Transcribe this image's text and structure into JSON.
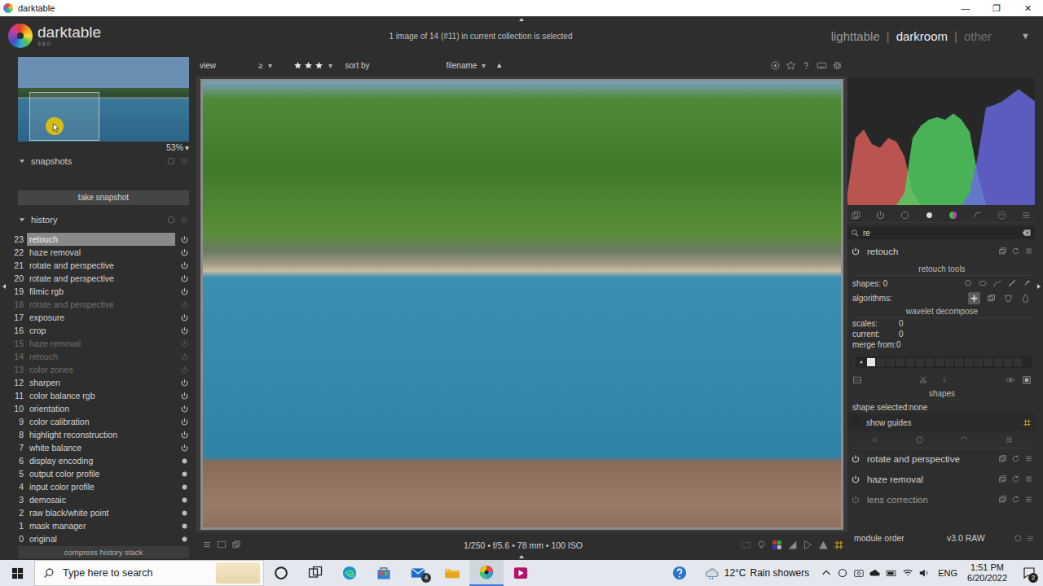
{
  "window": {
    "title": "darktable",
    "controls": [
      "—",
      "❐",
      "✕"
    ]
  },
  "header": {
    "logo": "darktable",
    "version": "3.8.0",
    "status": "1 image of 14 (#11) in current collection is selected",
    "views": [
      {
        "label": "lighttable",
        "selected": false
      },
      {
        "label": "darkroom",
        "selected": true
      },
      {
        "label": "other",
        "selected": false
      }
    ],
    "separator": "|",
    "menu": "▼"
  },
  "navigation": {
    "zoom": "53%",
    "zoom_menu": "▾"
  },
  "snapshots": {
    "title": "snapshots",
    "expanded": true,
    "button": "take snapshot"
  },
  "history": {
    "title": "history",
    "expanded": true,
    "items": [
      {
        "num": "23",
        "label": "retouch",
        "selected": true,
        "enabled": true,
        "kind": "toggle"
      },
      {
        "num": "22",
        "label": "haze removal",
        "selected": false,
        "enabled": true,
        "kind": "toggle"
      },
      {
        "num": "21",
        "label": "rotate and perspective",
        "selected": false,
        "enabled": true,
        "kind": "toggle"
      },
      {
        "num": "20",
        "label": "rotate and perspective",
        "selected": false,
        "enabled": true,
        "kind": "toggle"
      },
      {
        "num": "19",
        "label": "filmic rgb",
        "selected": false,
        "enabled": true,
        "kind": "toggle"
      },
      {
        "num": "18",
        "label": "rotate and perspective",
        "selected": false,
        "enabled": false,
        "kind": "toggle"
      },
      {
        "num": "17",
        "label": "exposure",
        "selected": false,
        "enabled": true,
        "kind": "toggle"
      },
      {
        "num": "16",
        "label": "crop",
        "selected": false,
        "enabled": true,
        "kind": "toggle"
      },
      {
        "num": "15",
        "label": "haze removal",
        "selected": false,
        "enabled": false,
        "kind": "toggle"
      },
      {
        "num": "14",
        "label": "retouch",
        "selected": false,
        "enabled": false,
        "kind": "toggle"
      },
      {
        "num": "13",
        "label": "color zones",
        "selected": false,
        "enabled": false,
        "kind": "toggle"
      },
      {
        "num": "12",
        "label": "sharpen",
        "selected": false,
        "enabled": true,
        "kind": "toggle"
      },
      {
        "num": "11",
        "label": "color balance rgb",
        "selected": false,
        "enabled": true,
        "kind": "toggle"
      },
      {
        "num": "10",
        "label": "orientation",
        "selected": false,
        "enabled": true,
        "kind": "toggle"
      },
      {
        "num": "9",
        "label": "color calibration",
        "selected": false,
        "enabled": true,
        "kind": "toggle"
      },
      {
        "num": "8",
        "label": "highlight reconstruction",
        "selected": false,
        "enabled": true,
        "kind": "toggle"
      },
      {
        "num": "7",
        "label": "white balance",
        "selected": false,
        "enabled": true,
        "kind": "toggle"
      },
      {
        "num": "6",
        "label": "display encoding",
        "selected": false,
        "enabled": true,
        "kind": "fixed"
      },
      {
        "num": "5",
        "label": "output color profile",
        "selected": false,
        "enabled": true,
        "kind": "fixed"
      },
      {
        "num": "4",
        "label": "input color profile",
        "selected": false,
        "enabled": true,
        "kind": "fixed"
      },
      {
        "num": "3",
        "label": "demosaic",
        "selected": false,
        "enabled": true,
        "kind": "fixed"
      },
      {
        "num": "2",
        "label": "raw black/white point",
        "selected": false,
        "enabled": true,
        "kind": "fixed"
      },
      {
        "num": "1",
        "label": "mask manager",
        "selected": false,
        "enabled": true,
        "kind": "fixed"
      },
      {
        "num": "0",
        "label": "original",
        "selected": false,
        "enabled": true,
        "kind": "fixed"
      }
    ],
    "footer": "compress history stack"
  },
  "toolbar": {
    "view": "view",
    "comparator": "≥",
    "comparator_menu": "▾",
    "stars": 3,
    "rating_menu": "▾",
    "sort_label": "sort by",
    "sort_field": "filename",
    "sort_menu": "▾",
    "sort_order": "▲"
  },
  "image_info": "1/250 • f/5.6 • 78 mm • 100 ISO",
  "histogram": {
    "series": [
      {
        "color": "#e0605c",
        "values": [
          0.1,
          0.55,
          0.62,
          0.5,
          0.47,
          0.55,
          0.52,
          0.4,
          0.1,
          0,
          0,
          0,
          0,
          0,
          0,
          0,
          0,
          0,
          0,
          0,
          0,
          0,
          0,
          0
        ]
      },
      {
        "color": "#52d463",
        "values": [
          0,
          0,
          0,
          0,
          0,
          0,
          0,
          0.1,
          0.55,
          0.65,
          0.7,
          0.72,
          0.7,
          0.75,
          0.7,
          0.6,
          0.25,
          0,
          0,
          0,
          0,
          0,
          0,
          0
        ]
      },
      {
        "color": "#6a6ae6",
        "values": [
          0,
          0,
          0,
          0,
          0,
          0,
          0,
          0,
          0,
          0,
          0,
          0,
          0,
          0,
          0,
          0.1,
          0.4,
          0.8,
          0.82,
          0.85,
          0.9,
          0.95,
          0.9,
          0.85
        ]
      }
    ]
  },
  "module_search": {
    "value": "re"
  },
  "retouch": {
    "name": "retouch",
    "enabled": true,
    "expanded": true,
    "tools_title": "retouch tools",
    "shapes_label": "shapes: 0",
    "algorithms_label": "algorithms:",
    "algorithms": [
      {
        "selected": true
      },
      {
        "selected": false
      },
      {
        "selected": false
      },
      {
        "selected": false
      }
    ],
    "wavelet_title": "wavelet decompose",
    "scales_label": "scales:",
    "scales_value": "0",
    "current_label": "current:",
    "current_value": "0",
    "merge_label": "merge from:0",
    "wavelet_level": 0,
    "shapes_title": "shapes",
    "shape_selected": "shape selected:none",
    "show_guides": {
      "label": "show guides",
      "checked": false
    }
  },
  "modules": [
    {
      "name": "rotate and perspective",
      "enabled": true
    },
    {
      "name": "haze removal",
      "enabled": true
    },
    {
      "name": "lens correction",
      "enabled": false
    }
  ],
  "module_order": {
    "label": "module order",
    "value": "v3.0 RAW"
  },
  "taskbar": {
    "search_placeholder": "Type here to search",
    "apps": [
      {
        "kind": "cortana",
        "active": false
      },
      {
        "kind": "taskview",
        "active": false
      },
      {
        "kind": "edge",
        "active": false
      },
      {
        "kind": "store",
        "active": false
      },
      {
        "kind": "mail",
        "active": false,
        "badge": "4"
      },
      {
        "kind": "explorer",
        "active": false
      },
      {
        "kind": "darktable",
        "active": true
      },
      {
        "kind": "media",
        "active": false
      }
    ],
    "weather": "12°C",
    "weather_text": "Rain showers",
    "keyboard": "ENG",
    "time": "1:51 PM",
    "date": "6/20/2022",
    "notifications": "2"
  }
}
